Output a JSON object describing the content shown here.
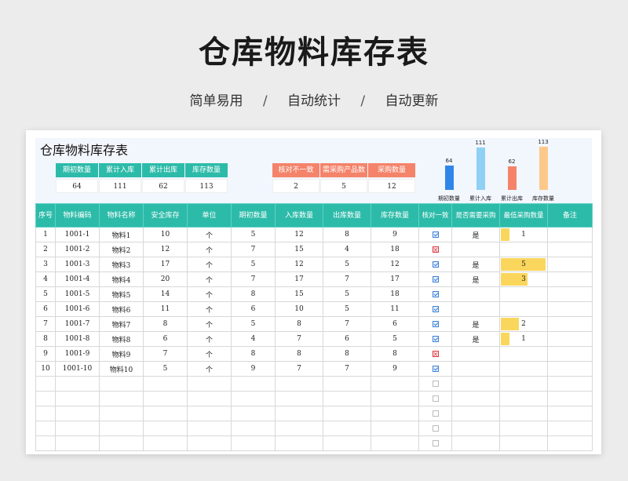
{
  "banner": {
    "title": "仓库物料库存表",
    "tags": [
      "简单易用",
      "自动统计",
      "自动更新"
    ],
    "separator": "/"
  },
  "sheet": {
    "title": "仓库物料库存表",
    "stats_left": [
      {
        "label": "期初数量",
        "value": "64"
      },
      {
        "label": "累计入库",
        "value": "111"
      },
      {
        "label": "累计出库",
        "value": "62"
      },
      {
        "label": "库存数量",
        "value": "113"
      }
    ],
    "stats_right": [
      {
        "label": "核对不一致",
        "value": "2"
      },
      {
        "label": "需采购产品数",
        "value": "5"
      },
      {
        "label": "采购数量",
        "value": "12"
      }
    ],
    "chart_data": {
      "type": "bar",
      "categories": [
        "期初数量",
        "累计入库",
        "累计出库",
        "库存数量"
      ],
      "values": [
        64,
        111,
        62,
        113
      ],
      "colors": [
        "#2f86e8",
        "#8fd0f5",
        "#f4836a",
        "#fcc98a"
      ],
      "ylim": [
        0,
        120
      ]
    },
    "columns": [
      "序号",
      "物料编码",
      "物料名称",
      "安全库存",
      "单位",
      "期初数量",
      "入库数量",
      "出库数量",
      "库存数量",
      "核对一致",
      "是否需要采购",
      "最低采购数量",
      "备注"
    ],
    "rows": [
      {
        "no": "1",
        "code": "1001-1",
        "name": "物料1",
        "safe": "10",
        "unit": "个",
        "init": "5",
        "in": "12",
        "out": "8",
        "stock": "9",
        "check": "ok",
        "need": "是",
        "min": 1,
        "note": ""
      },
      {
        "no": "2",
        "code": "1001-2",
        "name": "物料2",
        "safe": "12",
        "unit": "个",
        "init": "7",
        "in": "15",
        "out": "4",
        "stock": "18",
        "check": "bad",
        "need": "",
        "min": null,
        "note": ""
      },
      {
        "no": "3",
        "code": "1001-3",
        "name": "物料3",
        "safe": "17",
        "unit": "个",
        "init": "5",
        "in": "12",
        "out": "5",
        "stock": "12",
        "check": "ok",
        "need": "是",
        "min": 5,
        "note": ""
      },
      {
        "no": "4",
        "code": "1001-4",
        "name": "物料4",
        "safe": "20",
        "unit": "个",
        "init": "7",
        "in": "17",
        "out": "7",
        "stock": "17",
        "check": "ok",
        "need": "是",
        "min": 3,
        "note": ""
      },
      {
        "no": "5",
        "code": "1001-5",
        "name": "物料5",
        "safe": "14",
        "unit": "个",
        "init": "8",
        "in": "15",
        "out": "5",
        "stock": "18",
        "check": "ok",
        "need": "",
        "min": null,
        "note": ""
      },
      {
        "no": "6",
        "code": "1001-6",
        "name": "物料6",
        "safe": "11",
        "unit": "个",
        "init": "6",
        "in": "10",
        "out": "5",
        "stock": "11",
        "check": "ok",
        "need": "",
        "min": null,
        "note": ""
      },
      {
        "no": "7",
        "code": "1001-7",
        "name": "物料7",
        "safe": "8",
        "unit": "个",
        "init": "5",
        "in": "8",
        "out": "7",
        "stock": "6",
        "check": "ok",
        "need": "是",
        "min": 2,
        "note": ""
      },
      {
        "no": "8",
        "code": "1001-8",
        "name": "物料8",
        "safe": "6",
        "unit": "个",
        "init": "4",
        "in": "7",
        "out": "6",
        "stock": "5",
        "check": "ok",
        "need": "是",
        "min": 1,
        "note": ""
      },
      {
        "no": "9",
        "code": "1001-9",
        "name": "物料9",
        "safe": "7",
        "unit": "个",
        "init": "8",
        "in": "8",
        "out": "8",
        "stock": "8",
        "check": "bad",
        "need": "",
        "min": null,
        "note": ""
      },
      {
        "no": "10",
        "code": "1001-10",
        "name": "物料10",
        "safe": "5",
        "unit": "个",
        "init": "9",
        "in": "7",
        "out": "7",
        "stock": "9",
        "check": "ok",
        "need": "",
        "min": null,
        "note": ""
      }
    ],
    "empty_rows": 5,
    "min_max": 5
  }
}
